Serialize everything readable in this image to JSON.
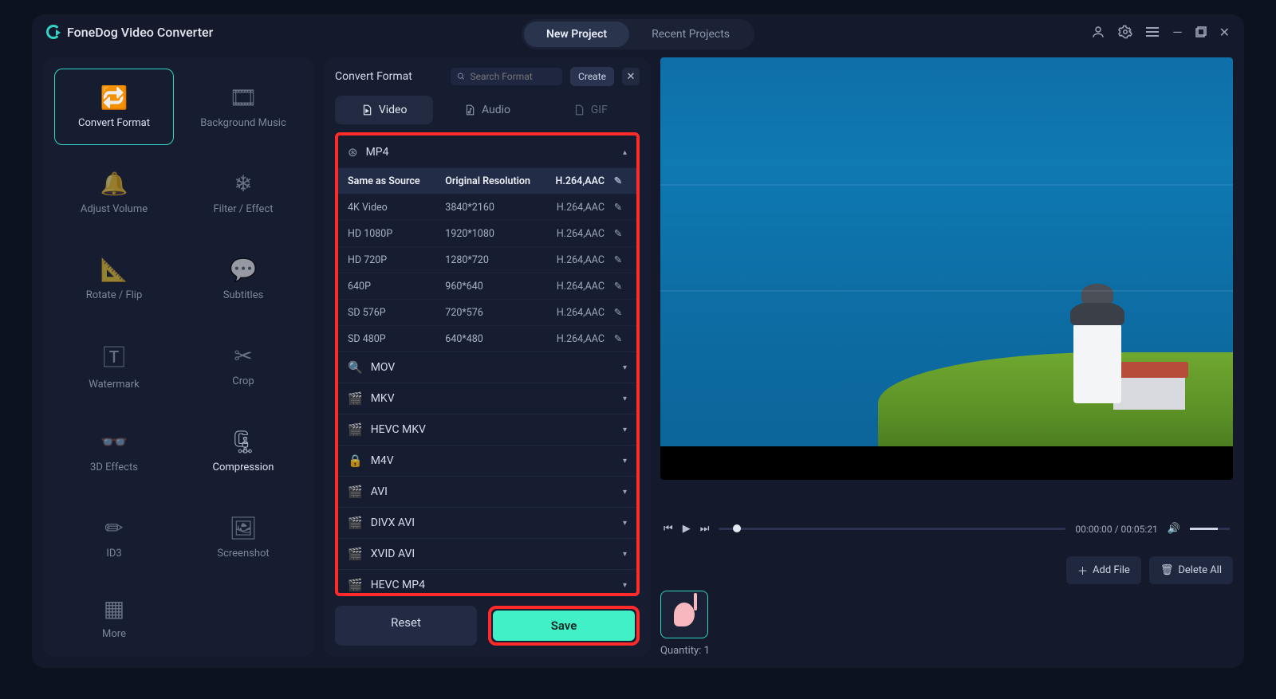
{
  "app": {
    "title": "FoneDog Video Converter"
  },
  "top_tabs": {
    "new": "New Project",
    "recent": "Recent Projects"
  },
  "tools": [
    {
      "label": "Convert Format",
      "name": "convert-format",
      "active": true
    },
    {
      "label": "Background Music",
      "name": "background-music"
    },
    {
      "label": "Adjust Volume",
      "name": "adjust-volume"
    },
    {
      "label": "Filter / Effect",
      "name": "filter-effect"
    },
    {
      "label": "Rotate / Flip",
      "name": "rotate-flip"
    },
    {
      "label": "Subtitles",
      "name": "subtitles"
    },
    {
      "label": "Watermark",
      "name": "watermark"
    },
    {
      "label": "Crop",
      "name": "crop"
    },
    {
      "label": "3D Effects",
      "name": "3d-effects"
    },
    {
      "label": "Compression",
      "name": "compression",
      "on": true
    },
    {
      "label": "ID3",
      "name": "id3"
    },
    {
      "label": "Screenshot",
      "name": "screenshot"
    },
    {
      "label": "More",
      "name": "more"
    }
  ],
  "panel": {
    "title": "Convert Format",
    "search_placeholder": "Search Format",
    "create": "Create",
    "tabs": {
      "video": "Video",
      "audio": "Audio",
      "gif": "GIF"
    },
    "mp4_label": "MP4",
    "options": [
      {
        "name": "Same as Source",
        "res": "Original Resolution",
        "codec": "H.264,AAC",
        "sel": true
      },
      {
        "name": "4K Video",
        "res": "3840*2160",
        "codec": "H.264,AAC"
      },
      {
        "name": "HD 1080P",
        "res": "1920*1080",
        "codec": "H.264,AAC"
      },
      {
        "name": "HD 720P",
        "res": "1280*720",
        "codec": "H.264,AAC"
      },
      {
        "name": "640P",
        "res": "960*640",
        "codec": "H.264,AAC"
      },
      {
        "name": "SD 576P",
        "res": "720*576",
        "codec": "H.264,AAC"
      },
      {
        "name": "SD 480P",
        "res": "640*480",
        "codec": "H.264,AAC"
      }
    ],
    "groups": [
      "MOV",
      "MKV",
      "HEVC MKV",
      "M4V",
      "AVI",
      "DIVX AVI",
      "XVID AVI",
      "HEVC MP4"
    ],
    "reset": "Reset",
    "save": "Save"
  },
  "player": {
    "time": "00:00:00 / 00:05:21"
  },
  "files": {
    "add": "Add File",
    "delete_all": "Delete All",
    "quantity_label": "Quantity:",
    "quantity": "1"
  }
}
